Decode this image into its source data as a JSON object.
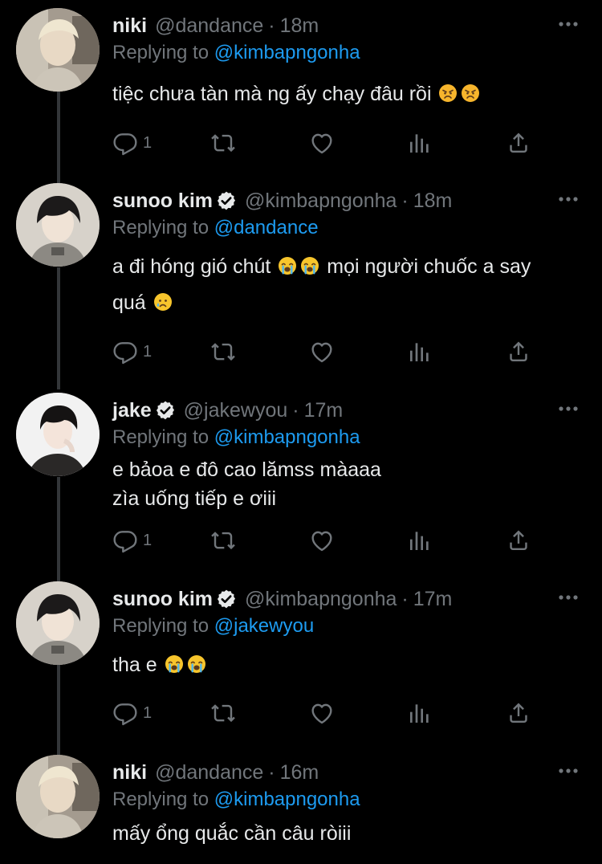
{
  "tweets": [
    {
      "name": "niki",
      "verified": false,
      "handle": "@dandance",
      "separator": "·",
      "time": "18m",
      "replying_prefix": "Replying to",
      "replying_to": "@kimbapngonha",
      "text": "tiệc chưa tàn mà ng ấy chạy đâu rồi",
      "emojis": [
        "angry-face",
        "angry-face"
      ],
      "reply_count": "1"
    },
    {
      "name": "sunoo kim",
      "verified": true,
      "handle": "@kimbapngonha",
      "separator": "·",
      "time": "18m",
      "replying_prefix": "Replying to",
      "replying_to": "@dandance",
      "text_line1": "a đi hóng gió chút",
      "text_mid": " mọi người chuốc a say",
      "text_line2": "quá",
      "emojis": [
        "loudly-crying-face",
        "loudly-crying-face",
        "crying-face"
      ],
      "reply_count": "1"
    },
    {
      "name": "jake",
      "verified": true,
      "handle": "@jakewyou",
      "separator": "·",
      "time": "17m",
      "replying_prefix": "Replying to",
      "replying_to": "@kimbapngonha",
      "text": "e bảoa e đô cao lămss màaaa\nzìa uống tiếp e ơiii",
      "reply_count": "1"
    },
    {
      "name": "sunoo kim",
      "verified": true,
      "handle": "@kimbapngonha",
      "separator": "·",
      "time": "17m",
      "replying_prefix": "Replying to",
      "replying_to": "@jakewyou",
      "text": "tha e",
      "emojis": [
        "loudly-crying-face",
        "loudly-crying-face"
      ],
      "reply_count": "1"
    },
    {
      "name": "niki",
      "verified": false,
      "handle": "@dandance",
      "separator": "·",
      "time": "16m",
      "replying_prefix": "Replying to",
      "replying_to": "@kimbapngonha",
      "text": "mấy ổng quắc cần câu ròiii"
    }
  ],
  "icons": {
    "reply": "reply-icon",
    "retweet": "retweet-icon",
    "like": "heart-icon",
    "analytics": "analytics-icon",
    "share": "share-icon",
    "more": "more-icon",
    "verified": "verified-badge-icon"
  },
  "colors": {
    "background": "#000000",
    "text": "#e7e9ea",
    "secondary": "#71767b",
    "accent": "#1d9bf0",
    "thread_line": "#333639"
  }
}
